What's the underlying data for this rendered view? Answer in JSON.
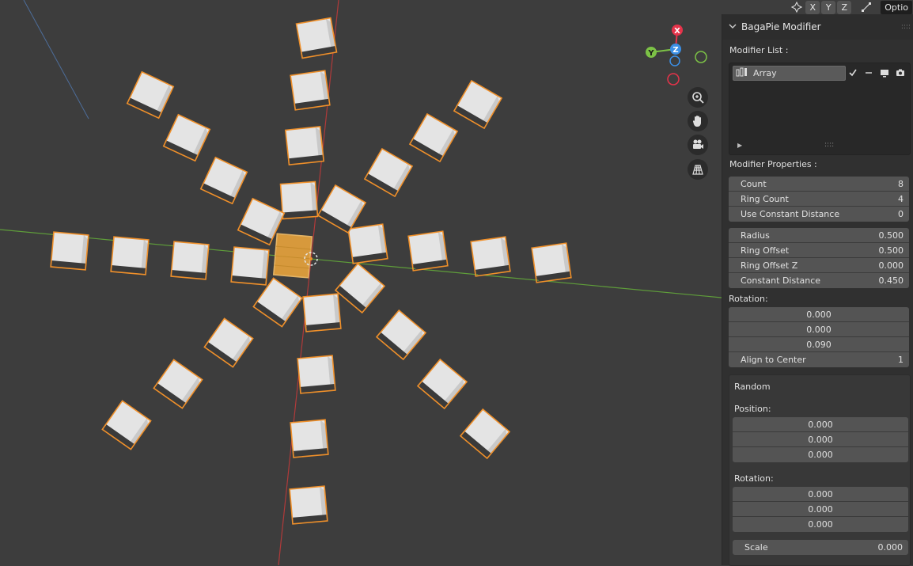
{
  "header": {
    "axis_buttons": [
      "X",
      "Y",
      "Z"
    ],
    "options_label": "Optio"
  },
  "gizmo": {
    "x_label": "X",
    "y_label": "Y",
    "z_label": "Z",
    "colors": {
      "x": "#e5334a",
      "y": "#7cc246",
      "z": "#3b8fe5"
    }
  },
  "nav_icons": [
    "zoom-icon",
    "hand-icon",
    "camera-icon",
    "grid-icon"
  ],
  "panel": {
    "title": "BagaPie Modifier",
    "modifier_list_label": "Modifier List :",
    "modifier_item": "Array",
    "modifier_properties_label": "Modifier Properties :",
    "props1": [
      {
        "label": "Count",
        "value": "8"
      },
      {
        "label": "Ring Count",
        "value": "4"
      },
      {
        "label": "Use Constant Distance",
        "value": "0"
      }
    ],
    "props2": [
      {
        "label": "Radius",
        "value": "0.500"
      },
      {
        "label": "Ring Offset",
        "value": "0.500"
      },
      {
        "label": "Ring Offset Z",
        "value": "0.000"
      },
      {
        "label": "Constant Distance",
        "value": "0.450"
      }
    ],
    "rotation_label": "Rotation:",
    "rotation_values": [
      "0.000",
      "0.000",
      "0.090"
    ],
    "align_label": "Align to Center",
    "align_value": "1",
    "random_label": "Random",
    "position_label": "Position:",
    "position_values": [
      "0.000",
      "0.000",
      "0.000"
    ],
    "random_rotation_label": "Rotation:",
    "random_rotation_values": [
      "0.000",
      "0.000",
      "0.000"
    ],
    "scale_label": "Scale",
    "scale_value": "0.000"
  },
  "colors": {
    "viewport_bg": "#3d3d3d",
    "selection_outline": "#f0902a",
    "active_object": "#e8a33c",
    "x_axis_line": "#b03a3a",
    "y_axis_line": "#5f9e3a"
  }
}
